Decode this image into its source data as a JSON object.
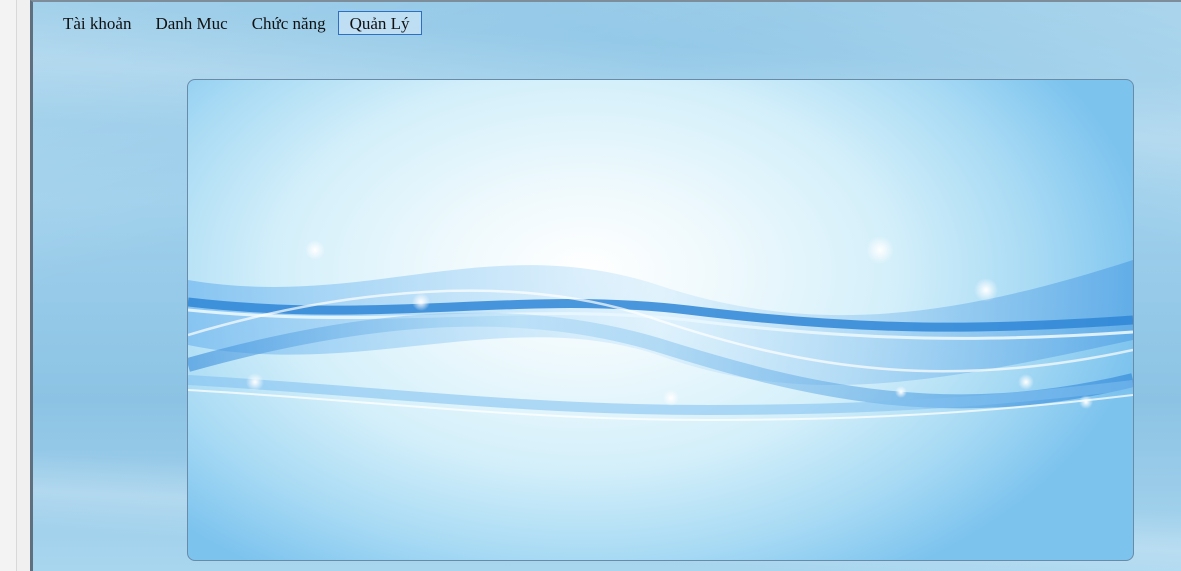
{
  "menu": {
    "items": [
      {
        "label": "Tài khoản",
        "active": false
      },
      {
        "label": "Danh Muc",
        "active": false
      },
      {
        "label": "Chức năng",
        "active": false
      },
      {
        "label": "Quản Lý",
        "active": true
      }
    ]
  },
  "colors": {
    "window_background": "#8ec6e6",
    "active_menu_border": "#2e6fc2",
    "wave_blue": "#4a9ee0"
  },
  "icons": [
    "sparkle-icon"
  ]
}
